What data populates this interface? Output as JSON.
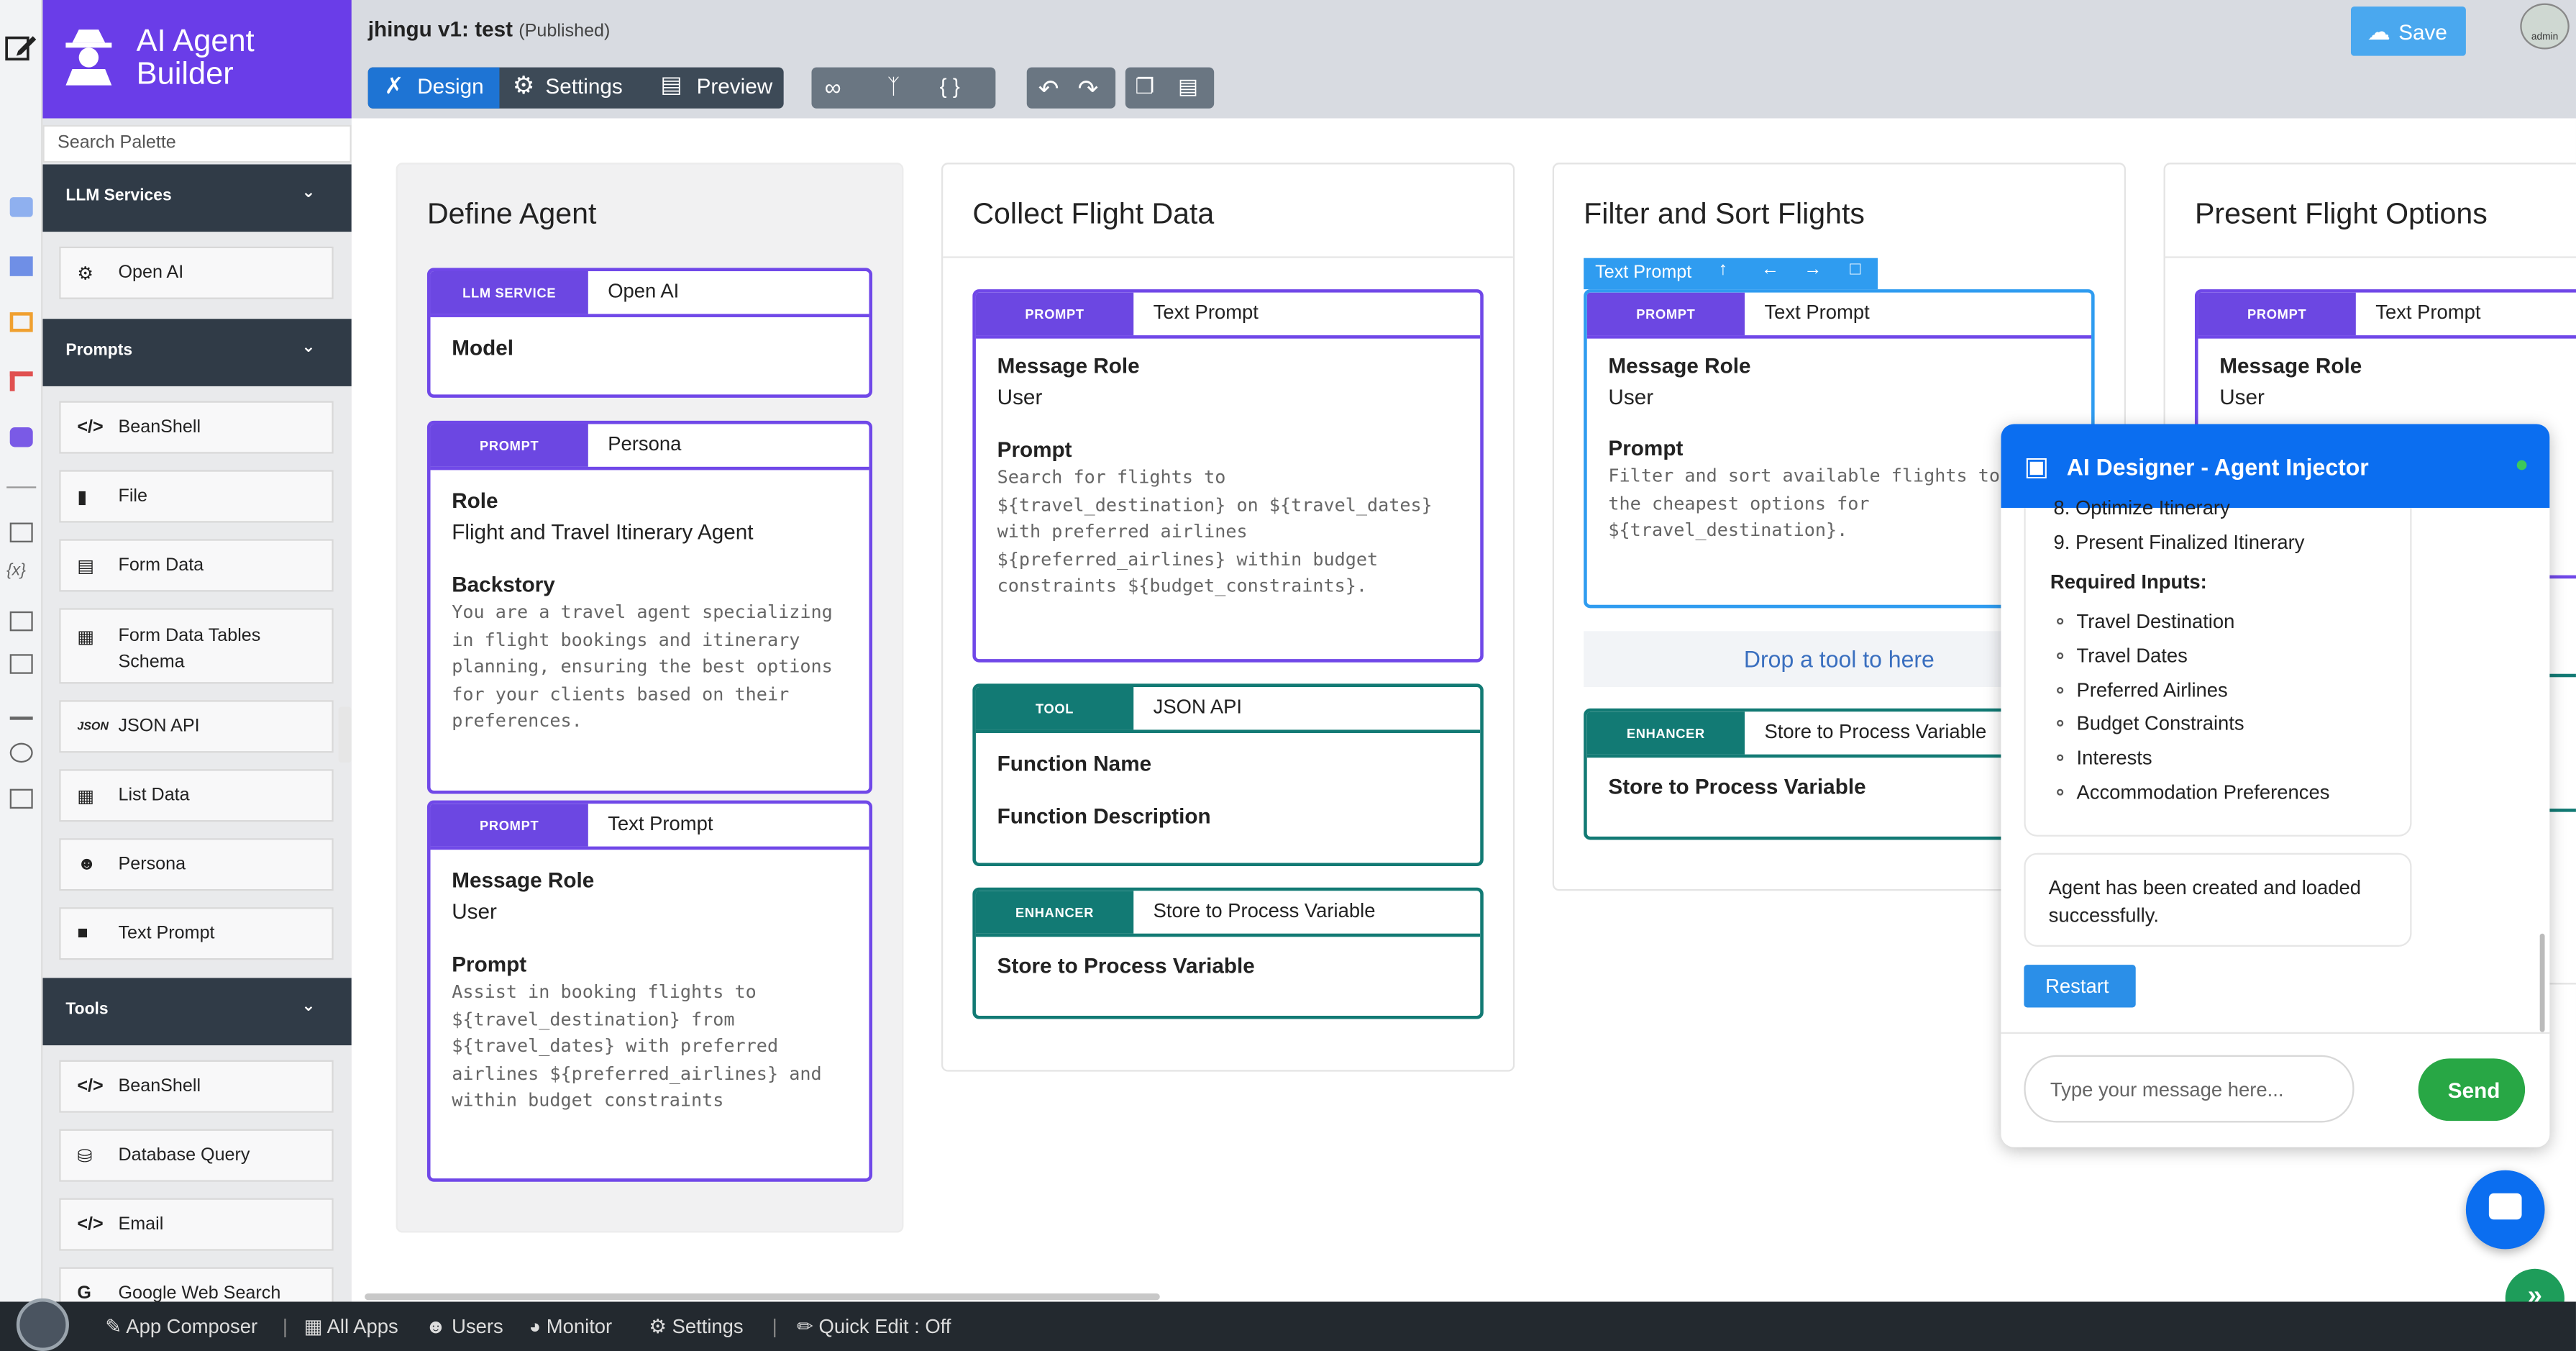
{
  "brand": {
    "title_line1": "AI Agent",
    "title_line2": "Builder"
  },
  "search": {
    "placeholder": "Search Palette"
  },
  "sidebar": {
    "llm_section": "LLM Services",
    "llm_items": [
      {
        "label": "Open AI",
        "icon": "openai-icon"
      }
    ],
    "prompts_section": "Prompts",
    "prompt_items": [
      {
        "label": "BeanShell",
        "icon": "code-icon"
      },
      {
        "label": "File",
        "icon": "file-icon"
      },
      {
        "label": "Form Data",
        "icon": "form-icon"
      },
      {
        "label": "Form Data Tables Schema",
        "icon": "table-icon"
      },
      {
        "label": "JSON API",
        "icon": "json-icon"
      },
      {
        "label": "List Data",
        "icon": "list-icon"
      },
      {
        "label": "Persona",
        "icon": "persona-icon"
      },
      {
        "label": "Text Prompt",
        "icon": "comment-icon"
      }
    ],
    "tools_section": "Tools",
    "tool_items": [
      {
        "label": "BeanShell",
        "icon": "code-icon"
      },
      {
        "label": "Database Query",
        "icon": "database-icon"
      },
      {
        "label": "Email",
        "icon": "code-icon"
      },
      {
        "label": "Google Web Search",
        "icon": "google-icon"
      }
    ]
  },
  "header": {
    "title": "jhingu v1: test",
    "status": "(Published)",
    "tabs": [
      "Design",
      "Settings",
      "Preview"
    ],
    "save_label": "Save",
    "avatar_text": "admin"
  },
  "columns": [
    {
      "title": "Define Agent",
      "cards": [
        {
          "tag": "LLM SERVICE",
          "value": "Open AI",
          "fields": [
            {
              "label": "Model",
              "value": ""
            }
          ]
        },
        {
          "tag": "PROMPT",
          "value": "Persona",
          "fields": [
            {
              "label": "Role",
              "value": "Flight and Travel Itinerary Agent"
            },
            {
              "label": "Backstory",
              "value": "You are a travel agent specializing\nin flight bookings and itinerary\nplanning, ensuring the best options\nfor your clients based on their\npreferences."
            }
          ]
        },
        {
          "tag": "PROMPT",
          "value": "Text Prompt",
          "fields": [
            {
              "label": "Message Role",
              "value": "User"
            },
            {
              "label": "Prompt",
              "value": "Assist in booking flights to\n${travel_destination} from\n${travel_dates} with preferred\nairlines ${preferred_airlines} and\nwithin budget constraints"
            }
          ]
        }
      ]
    },
    {
      "title": "Collect Flight Data",
      "cards": [
        {
          "tag": "PROMPT",
          "value": "Text Prompt",
          "fields": [
            {
              "label": "Message Role",
              "value": "User"
            },
            {
              "label": "Prompt",
              "value": "Search for flights to\n${travel_destination} on ${travel_dates}\nwith preferred airlines\n${preferred_airlines} within budget\nconstraints ${budget_constraints}."
            }
          ]
        },
        {
          "tag": "TOOL",
          "value": "JSON API",
          "fields": [
            {
              "label": "Function Name",
              "value": ""
            },
            {
              "label": "Function Description",
              "value": ""
            }
          ]
        },
        {
          "tag": "ENHANCER",
          "value": "Store to Process Variable",
          "fields": [
            {
              "label": "Store to Process Variable",
              "value": ""
            }
          ]
        }
      ]
    },
    {
      "title": "Filter and Sort Flights",
      "toolbar_label": "Text Prompt",
      "cards": [
        {
          "tag": "PROMPT",
          "value": "Text Prompt",
          "fields": [
            {
              "label": "Message Role",
              "value": "User"
            },
            {
              "label": "Prompt",
              "value": "Filter and sort available flights to\nthe cheapest options for\n${travel_destination}."
            }
          ]
        },
        {
          "tag": "ENHANCER",
          "value": "Store to Process Variable",
          "fields": [
            {
              "label": "Store to Process Variable",
              "value": ""
            }
          ]
        }
      ],
      "drop_text": "Drop a tool to here"
    },
    {
      "title": "Present Flight Options",
      "cards": [
        {
          "tag": "PROMPT",
          "value": "Text Prompt",
          "fields": [
            {
              "label": "Message Role",
              "value": "User"
            }
          ]
        }
      ]
    }
  ],
  "chat": {
    "title": "AI Designer - Agent Injector",
    "steps": [
      "8. Optimize Itinerary",
      "9. Present Finalized Itinerary"
    ],
    "required_title": "Required Inputs:",
    "inputs": [
      "Travel Destination",
      "Travel Dates",
      "Preferred Airlines",
      "Budget Constraints",
      "Interests",
      "Accommodation Preferences"
    ],
    "bot_message": "Agent has been created and loaded successfully.",
    "restart_label": "Restart",
    "input_placeholder": "Type your message here...",
    "send_label": "Send"
  },
  "bottom": {
    "items": [
      "App Composer",
      "All Apps",
      "Users",
      "Monitor",
      "Settings",
      "Quick Edit : Off"
    ]
  },
  "colors": {
    "accent": "#6a3de8",
    "tool": "#127a74",
    "chat_header": "#0b6ef0",
    "send": "#28a745"
  }
}
